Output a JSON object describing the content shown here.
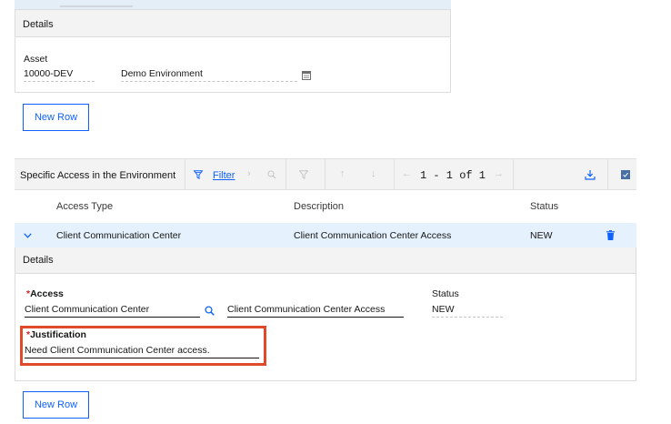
{
  "top_details": {
    "header": "Details",
    "asset_label": "Asset",
    "asset_value": "10000-DEV",
    "asset_description": "Demo Environment",
    "new_row_label": "New Row"
  },
  "table": {
    "title": "Specific Access in the Environment",
    "filter_label": "Filter",
    "pager_text": "1 - 1 of 1",
    "columns": [
      "Access Type",
      "Description",
      "Status"
    ],
    "rows": [
      {
        "access_type": "Client Communication Center",
        "description": "Client Communication Center Access",
        "status": "NEW"
      }
    ]
  },
  "row_details": {
    "header": "Details",
    "access_label": "Access",
    "access_value": "Client Communication Center",
    "access_description": "Client Communication Center Access",
    "status_label": "Status",
    "status_value": "NEW",
    "justification_label": "Justification",
    "justification_value": "Need Client Communication Center access.",
    "required_mark": "*",
    "new_row_label": "New Row"
  },
  "colors": {
    "accent": "#0f62fe",
    "row_selected": "#e5f1fc",
    "highlight": "#e04a2b",
    "required": "#da1e28"
  },
  "icons": {
    "asset_lookup": "calendar-grid-icon",
    "filter": "filter-icon",
    "search": "magnifier-icon",
    "download": "download-icon",
    "delete": "trash-icon",
    "expand": "chevron-down-icon"
  }
}
